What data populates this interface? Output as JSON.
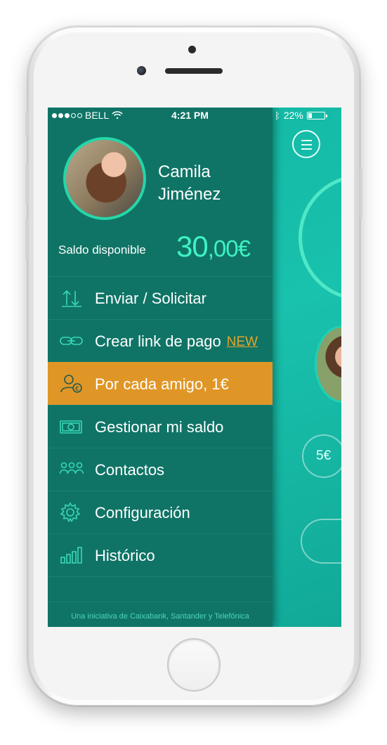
{
  "status_bar": {
    "carrier": "BELL",
    "time": "4:21 PM",
    "battery": "22%",
    "battery_level": 0.22
  },
  "profile": {
    "first_name": "Camila",
    "last_name": "Jiménez"
  },
  "balance": {
    "label": "Saldo disponible",
    "integer": "30",
    "decimal": ",00€"
  },
  "menu": {
    "items": [
      {
        "label": "Enviar / Solicitar",
        "icon": "transfer-arrows-icon"
      },
      {
        "label": "Crear link de pago",
        "icon": "link-icon",
        "badge": "NEW"
      },
      {
        "label": "Por cada amigo, 1€",
        "icon": "invite-friend-icon",
        "active": true
      },
      {
        "label": "Gestionar mi saldo",
        "icon": "banknote-icon"
      },
      {
        "label": "Contactos",
        "icon": "contacts-icon"
      },
      {
        "label": "Configuración",
        "icon": "gear-icon"
      },
      {
        "label": "Histórico",
        "icon": "bar-chart-icon"
      }
    ]
  },
  "footer": {
    "text": "Una iniciativa de Caixabank, Santander y Telefónica"
  },
  "background": {
    "amount": "5€"
  },
  "colors": {
    "drawer": "#0f7466",
    "accent": "#3ef2c4",
    "active_item": "#e09626",
    "new_badge": "#e6a429",
    "app_background": "#19c2ad"
  }
}
